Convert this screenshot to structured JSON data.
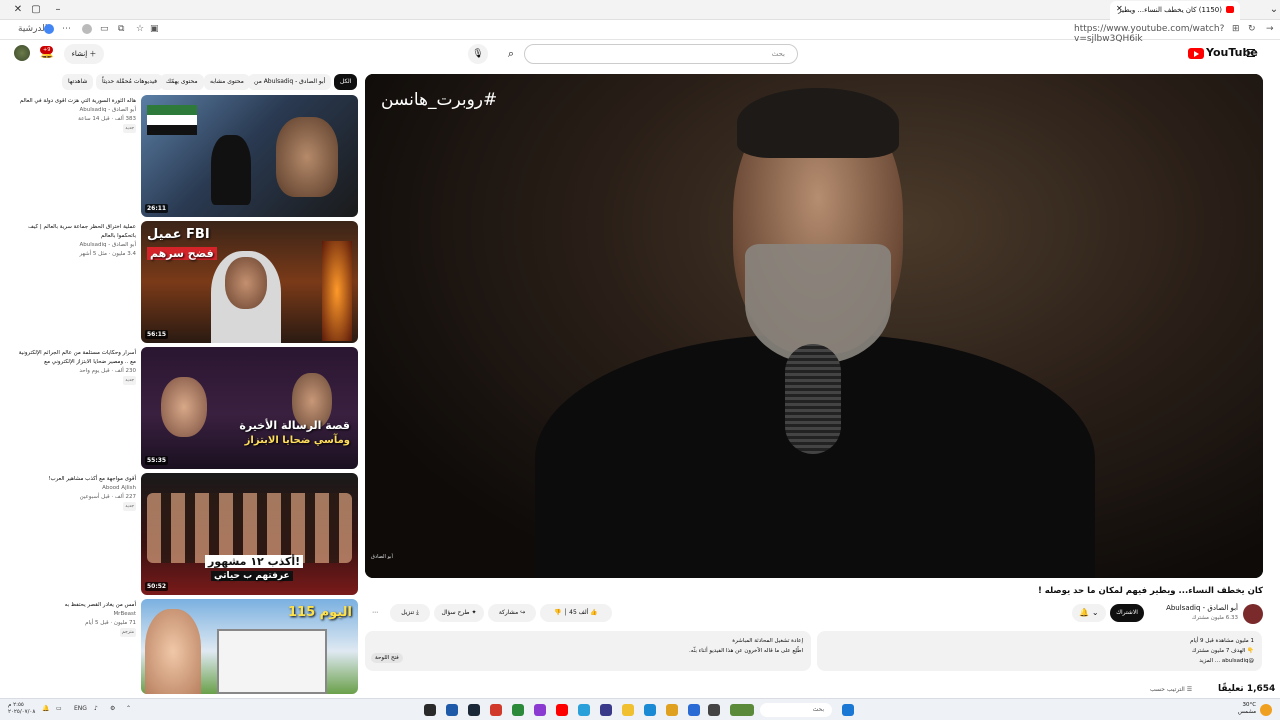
{
  "browser": {
    "tab_title": "(1150) كان يخطف النساء... ويطير",
    "url": "https://www.youtube.com/watch?v=sjlbw3QH6ik",
    "profile_label": "الدرشية"
  },
  "header": {
    "logo_text": "YouTube",
    "search_placeholder": "بحث",
    "create_label": "إنشاء",
    "notification_count": "+9"
  },
  "chips": [
    "الكل",
    "من Abulsadiq - أبو الصادق",
    "محتوى مشابه",
    "محتوى يهمّك",
    "فيديوهات مُحمَّلة حديثاً",
    "شاهدتها"
  ],
  "video": {
    "overlay_hashtag": "#روبرت_هانسن",
    "watermark": "أبو الصادق",
    "title": "كان يخطف النساء... ويطير فيهم لمكان ما حد يوصله !",
    "channel_name": "أبو الصادق - Abulsadiq",
    "subscribers": "6.33 مليون مشترك",
    "subscribe_label": "الاشتراك",
    "likes": "45 ألف",
    "share_label": "مشاركة",
    "ask_label": "طرح سؤال",
    "download_label": "تنزيل",
    "description_line1": "1 مليون مشاهدة قبل 9 أيام",
    "description_line2": "👇 الهدف 7 مليون مشترك",
    "description_line3": "@abulsadiq ... المزيد",
    "chat_title": "إعادة تشغيل المحادثة المباشرة",
    "chat_text": "اطّلِع على ما قاله الآخرون عن هذا الفيديو أثناء بثّه.",
    "chat_button": "فتح اللوحة",
    "comments_count": "1,654 تعليقًا",
    "sort_label": "الترتيب حسب"
  },
  "recommendations": [
    {
      "title": "هاله الثورة السورية التي هزت اقوى دولة في العالم",
      "channel": "أبو الصادق - Abulsadiq",
      "meta": "383 ألف · قبل 14 ساعة",
      "badge": "جديد",
      "duration": "26:11"
    },
    {
      "title": "عملية اختراق الحظر جماعة سرية بالعالم | كيف باتحكموا بالعالم",
      "channel": "أبو الصادق - Abulsadiq",
      "meta": "3.4 مليون · مثل 5 أشهر",
      "badge": "",
      "duration": "56:15",
      "thumb_text1": "عميل FBI",
      "thumb_text2": "فضح سرهم"
    },
    {
      "title": "أسرار وحكايات مستلمة من عالم الجرائم الإلكترونية مع .. ومصير ضحايا الابتزاز الإلكتروني مع",
      "channel": "",
      "meta": "230 ألف · قبل يوم واحد",
      "badge": "جديد",
      "duration": "55:35",
      "thumb_text1": "قصة الرسالة الأخيرة",
      "thumb_text2": "ومآسي ضحايا الابتزاز"
    },
    {
      "title": "أقوى مواجهة مع أكذب مشاهير العرب!",
      "channel": "Abood Ajlish",
      "meta": "227 ألف · قبل أسبوعين",
      "badge": "جديد",
      "duration": "50:52",
      "thumb_text1": "أكذب ١٢ مشهور!",
      "thumb_text2": "عرفتهم ب حياتي"
    },
    {
      "title": "أمس من يغادر القصر يحتفظ به",
      "channel": "MrBeast",
      "meta": "71 مليون · قبل 5 أيام",
      "badge": "مترجم",
      "duration": "",
      "thumb_text1": "اليوم 115"
    }
  ],
  "taskbar": {
    "search_placeholder": "بحث",
    "language": "ENG",
    "weather_temp": "30°C",
    "weather_desc": "مشمس",
    "time": "٢:٥٥ م",
    "date": "٢٠٢٥/٠٧/٠٨"
  }
}
